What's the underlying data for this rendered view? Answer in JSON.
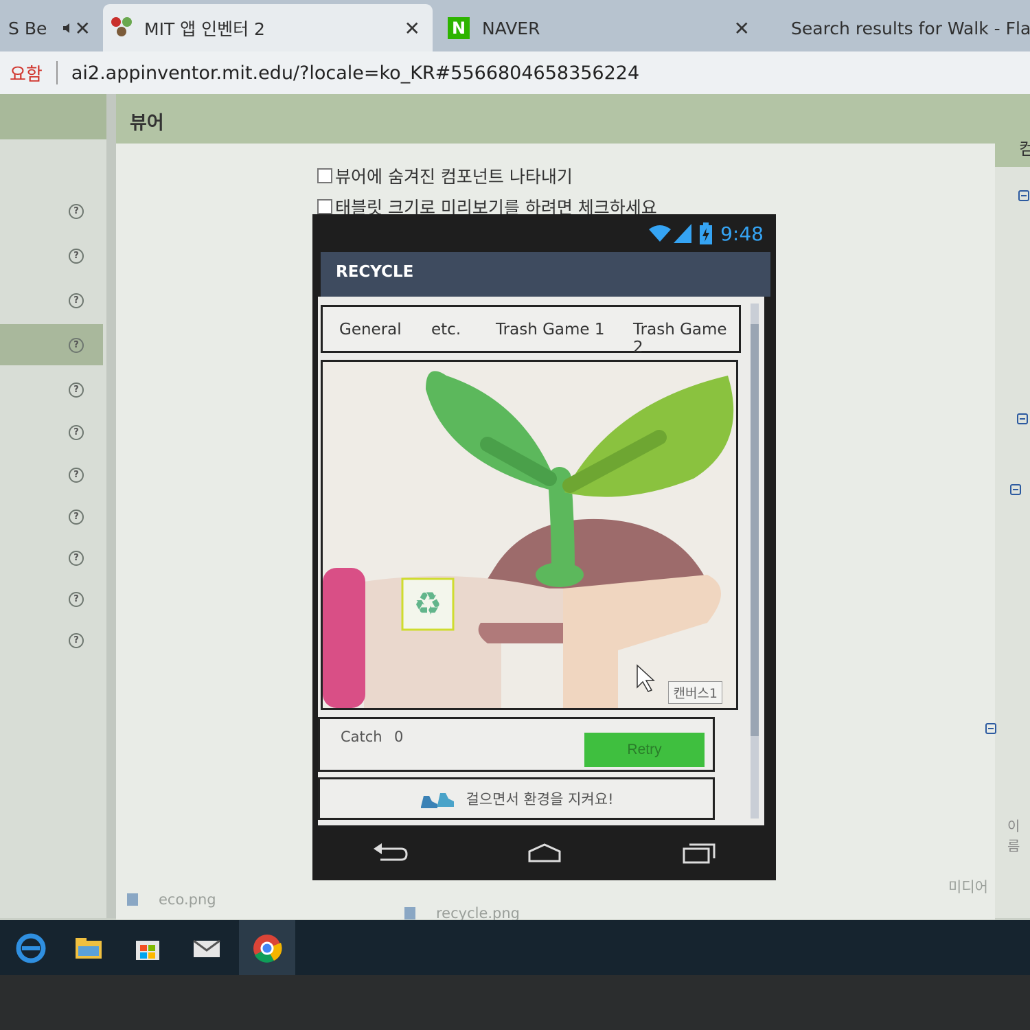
{
  "browser": {
    "tabs": [
      {
        "title": "S Be",
        "active": false
      },
      {
        "title": "MIT 앱 인벤터 2",
        "active": true
      },
      {
        "title": "NAVER",
        "active": false
      },
      {
        "title": "Search results for Walk - Fla",
        "active": false
      }
    ],
    "close_glyph": "✕",
    "address": {
      "note": "요함",
      "url": "ai2.appinventor.mit.edu/?locale=ko_KR#5566804658356224"
    }
  },
  "designer": {
    "viewer_title": "뷰어",
    "right_panel_partial": "컴",
    "checkboxes": [
      {
        "label": "뷰어에 숨겨진 컴포넌트 나타내기",
        "checked": false
      },
      {
        "label": "태블릿 크기로 미리보기를 하려면 체크하세요",
        "checked": false
      }
    ],
    "right_partial_label": "이름",
    "media_label": "미디어"
  },
  "phone": {
    "time": "9:48",
    "screen_title": "RECYCLE",
    "tabs": [
      "General",
      "etc.",
      "Trash Game 1",
      "Trash Game 2"
    ],
    "canvas_name": "캔버스1",
    "catch_label": "Catch",
    "catch_value": "0",
    "retry_label": "Retry",
    "walk_message": "걸으면서 환경을 지켜요!"
  },
  "media_files": [
    "eco.png",
    "recycle.png"
  ],
  "colors": {
    "title_bar": "#3e4b5f",
    "viewer_header": "#b3c4a5",
    "retry_button": "#3fbf3f",
    "status_time": "#35a4f4"
  }
}
